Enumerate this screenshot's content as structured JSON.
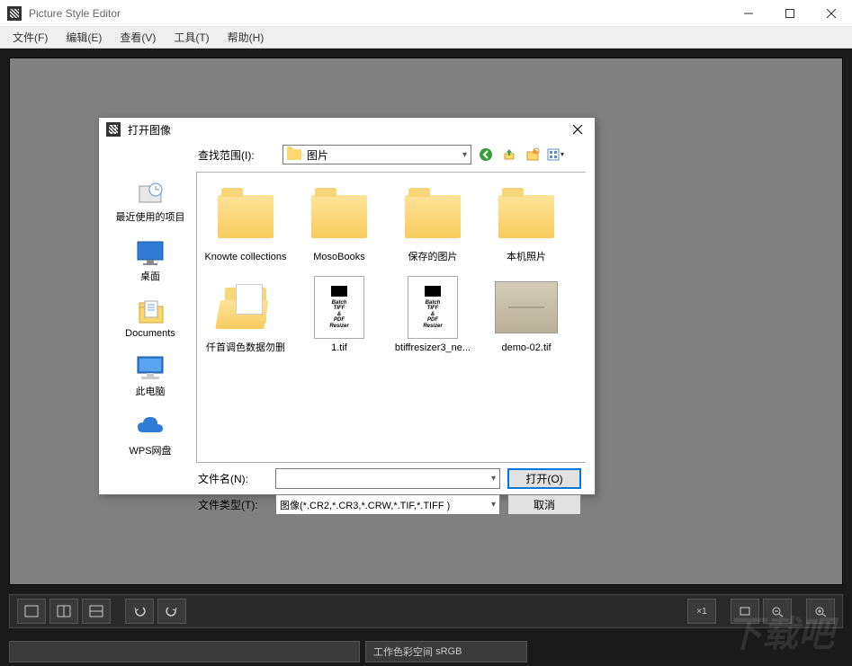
{
  "window": {
    "title": "Picture Style Editor"
  },
  "menu": {
    "items": [
      "文件(F)",
      "编辑(E)",
      "查看(V)",
      "工具(T)",
      "帮助(H)"
    ]
  },
  "status": {
    "colorspace_label": "工作色彩空间",
    "colorspace_value": "sRGB"
  },
  "dialog": {
    "title": "打开图像",
    "lookin_label": "查找范围(I):",
    "lookin_value": "图片",
    "places": [
      {
        "label": "最近使用的项目",
        "icon": "recent"
      },
      {
        "label": "桌面",
        "icon": "desktop"
      },
      {
        "label": "Documents",
        "icon": "documents"
      },
      {
        "label": "此电脑",
        "icon": "computer"
      },
      {
        "label": "WPS网盘",
        "icon": "cloud"
      }
    ],
    "files": [
      {
        "name": "Knowte collections",
        "type": "folder"
      },
      {
        "name": "MosoBooks",
        "type": "folder"
      },
      {
        "name": "保存的图片",
        "type": "folder"
      },
      {
        "name": "本机照片",
        "type": "folder"
      },
      {
        "name": "仟首调色数据勿删",
        "type": "folder-open"
      },
      {
        "name": "1.tif",
        "type": "doc"
      },
      {
        "name": "btiffresizer3_ne...",
        "type": "doc"
      },
      {
        "name": "demo-02.tif",
        "type": "photo"
      }
    ],
    "doc_text": "Batch TIFF & PDF Resizer",
    "filename_label": "文件名(N):",
    "filename_value": "",
    "filetype_label": "文件类型(T):",
    "filetype_value": "图像(*.CR2,*.CR3,*.CRW,*.TIF,*.TIFF )",
    "open_btn": "打开(O)",
    "cancel_btn": "取消"
  }
}
